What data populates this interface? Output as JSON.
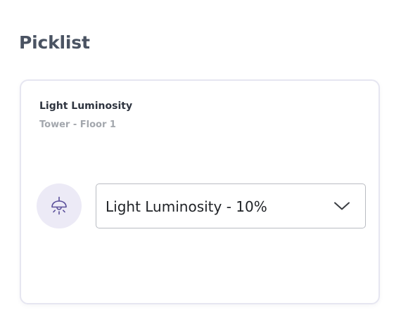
{
  "page": {
    "title": "Picklist"
  },
  "card": {
    "title": "Light Luminosity",
    "subtitle": "Tower - Floor 1",
    "icon": "ceiling-lamp-icon",
    "select": {
      "selected": "Light Luminosity - 10%",
      "icon": "chevron-down-icon"
    }
  },
  "colors": {
    "title": "#4a5362",
    "icon_bg": "#eceaf6",
    "icon_stroke": "#5a4f9a",
    "border": "#b9bcc2"
  }
}
